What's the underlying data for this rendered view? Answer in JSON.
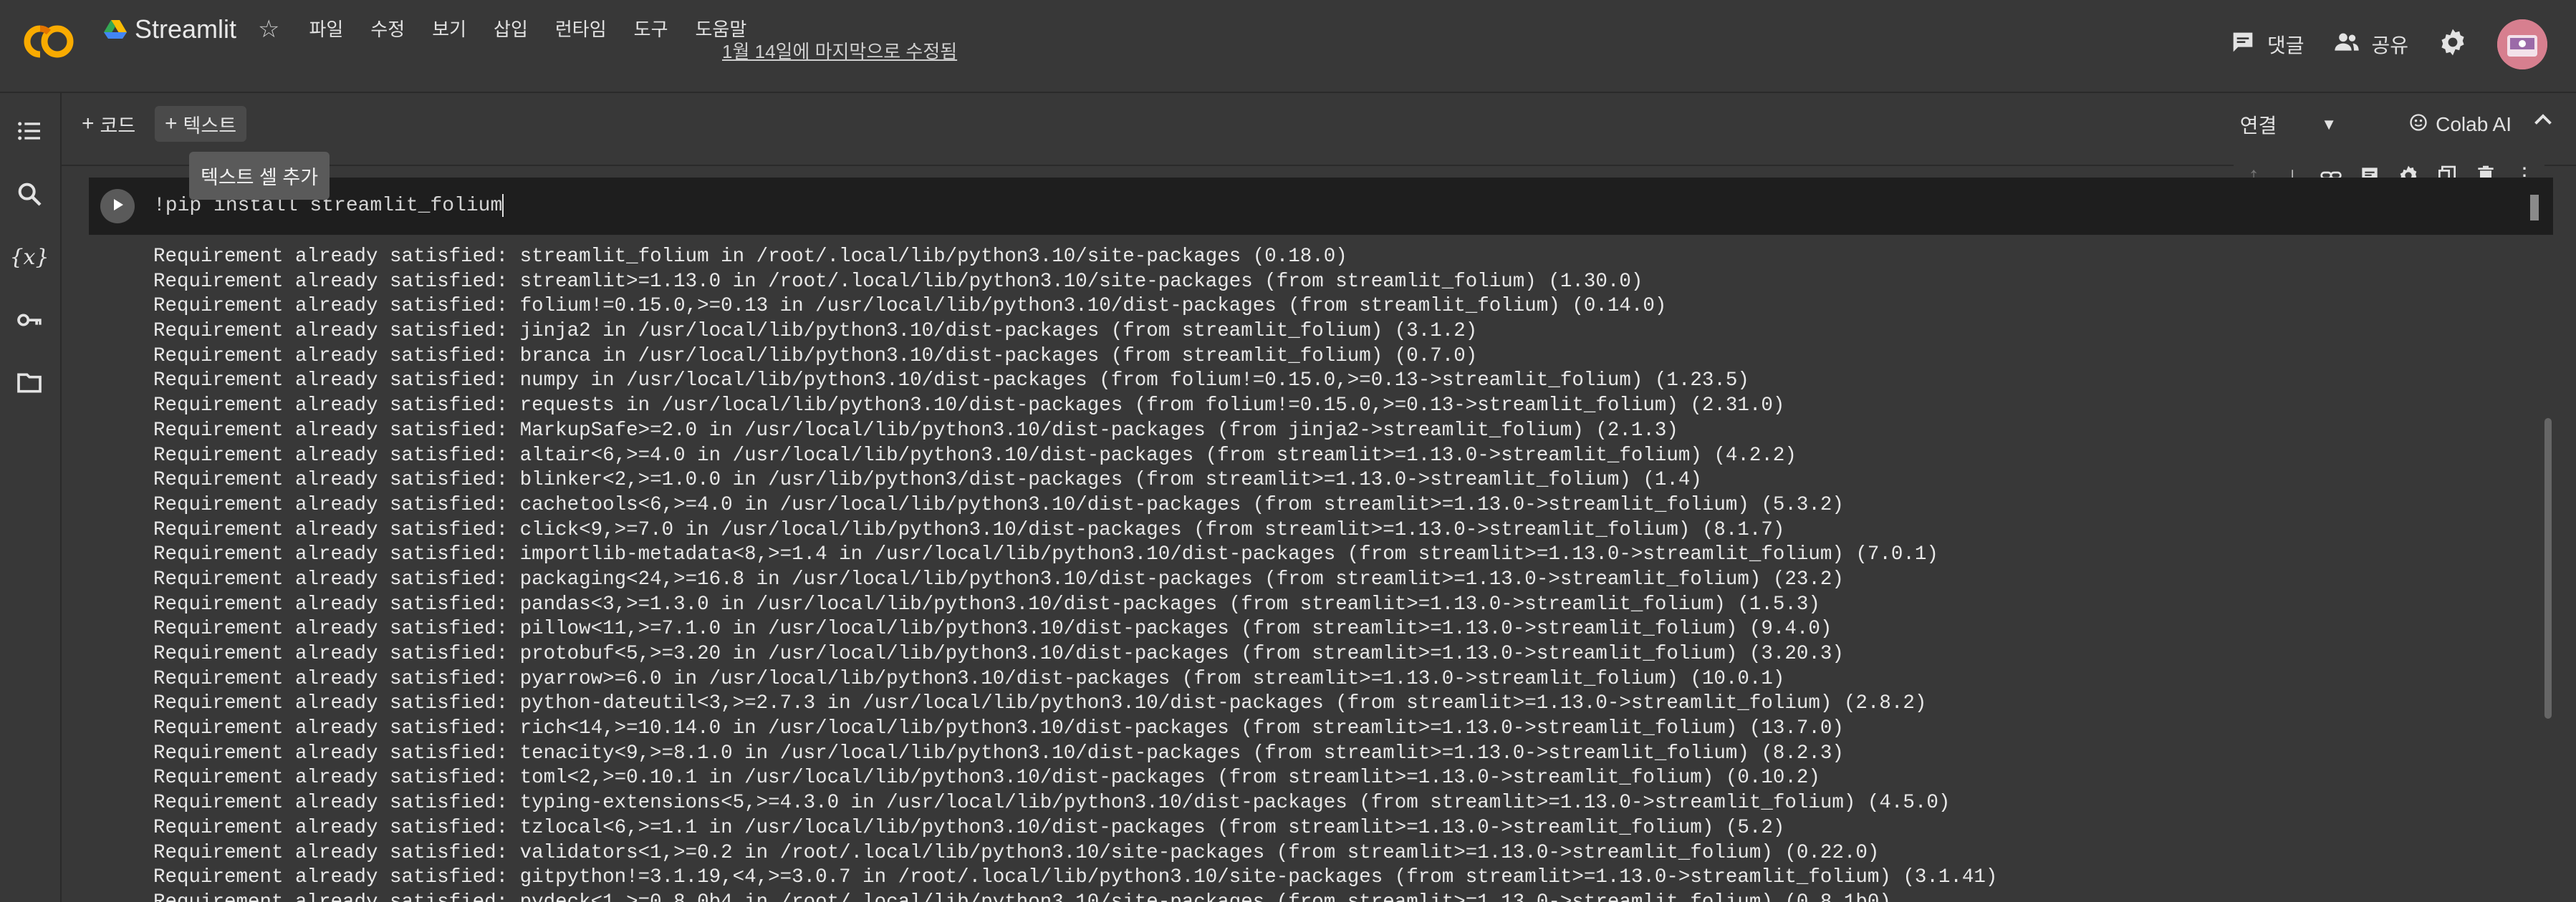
{
  "header": {
    "app_name": "Streamlit",
    "menu": [
      "파일",
      "수정",
      "보기",
      "삽입",
      "런타임",
      "도구",
      "도움말"
    ],
    "last_edited": "1월 14일에 마지막으로 수정됨",
    "comment_label": "댓글",
    "share_label": "공유"
  },
  "toolbar": {
    "code_label": "코드",
    "text_label": "텍스트",
    "tooltip": "텍스트 셀 추가",
    "connect_label": "연결",
    "colab_ai_label": "Colab AI"
  },
  "cell": {
    "code": "!pip install streamlit_folium"
  },
  "output": {
    "lines": [
      "Requirement already satisfied: streamlit_folium in /root/.local/lib/python3.10/site-packages (0.18.0)",
      "Requirement already satisfied: streamlit>=1.13.0 in /root/.local/lib/python3.10/site-packages (from streamlit_folium) (1.30.0)",
      "Requirement already satisfied: folium!=0.15.0,>=0.13 in /usr/local/lib/python3.10/dist-packages (from streamlit_folium) (0.14.0)",
      "Requirement already satisfied: jinja2 in /usr/local/lib/python3.10/dist-packages (from streamlit_folium) (3.1.2)",
      "Requirement already satisfied: branca in /usr/local/lib/python3.10/dist-packages (from streamlit_folium) (0.7.0)",
      "Requirement already satisfied: numpy in /usr/local/lib/python3.10/dist-packages (from folium!=0.15.0,>=0.13->streamlit_folium) (1.23.5)",
      "Requirement already satisfied: requests in /usr/local/lib/python3.10/dist-packages (from folium!=0.15.0,>=0.13->streamlit_folium) (2.31.0)",
      "Requirement already satisfied: MarkupSafe>=2.0 in /usr/local/lib/python3.10/dist-packages (from jinja2->streamlit_folium) (2.1.3)",
      "Requirement already satisfied: altair<6,>=4.0 in /usr/local/lib/python3.10/dist-packages (from streamlit>=1.13.0->streamlit_folium) (4.2.2)",
      "Requirement already satisfied: blinker<2,>=1.0.0 in /usr/lib/python3/dist-packages (from streamlit>=1.13.0->streamlit_folium) (1.4)",
      "Requirement already satisfied: cachetools<6,>=4.0 in /usr/local/lib/python3.10/dist-packages (from streamlit>=1.13.0->streamlit_folium) (5.3.2)",
      "Requirement already satisfied: click<9,>=7.0 in /usr/local/lib/python3.10/dist-packages (from streamlit>=1.13.0->streamlit_folium) (8.1.7)",
      "Requirement already satisfied: importlib-metadata<8,>=1.4 in /usr/local/lib/python3.10/dist-packages (from streamlit>=1.13.0->streamlit_folium) (7.0.1)",
      "Requirement already satisfied: packaging<24,>=16.8 in /usr/local/lib/python3.10/dist-packages (from streamlit>=1.13.0->streamlit_folium) (23.2)",
      "Requirement already satisfied: pandas<3,>=1.3.0 in /usr/local/lib/python3.10/dist-packages (from streamlit>=1.13.0->streamlit_folium) (1.5.3)",
      "Requirement already satisfied: pillow<11,>=7.1.0 in /usr/local/lib/python3.10/dist-packages (from streamlit>=1.13.0->streamlit_folium) (9.4.0)",
      "Requirement already satisfied: protobuf<5,>=3.20 in /usr/local/lib/python3.10/dist-packages (from streamlit>=1.13.0->streamlit_folium) (3.20.3)",
      "Requirement already satisfied: pyarrow>=6.0 in /usr/local/lib/python3.10/dist-packages (from streamlit>=1.13.0->streamlit_folium) (10.0.1)",
      "Requirement already satisfied: python-dateutil<3,>=2.7.3 in /usr/local/lib/python3.10/dist-packages (from streamlit>=1.13.0->streamlit_folium) (2.8.2)",
      "Requirement already satisfied: rich<14,>=10.14.0 in /usr/local/lib/python3.10/dist-packages (from streamlit>=1.13.0->streamlit_folium) (13.7.0)",
      "Requirement already satisfied: tenacity<9,>=8.1.0 in /usr/local/lib/python3.10/dist-packages (from streamlit>=1.13.0->streamlit_folium) (8.2.3)",
      "Requirement already satisfied: toml<2,>=0.10.1 in /usr/local/lib/python3.10/dist-packages (from streamlit>=1.13.0->streamlit_folium) (0.10.2)",
      "Requirement already satisfied: typing-extensions<5,>=4.3.0 in /usr/local/lib/python3.10/dist-packages (from streamlit>=1.13.0->streamlit_folium) (4.5.0)",
      "Requirement already satisfied: tzlocal<6,>=1.1 in /usr/local/lib/python3.10/dist-packages (from streamlit>=1.13.0->streamlit_folium) (5.2)",
      "Requirement already satisfied: validators<1,>=0.2 in /root/.local/lib/python3.10/site-packages (from streamlit>=1.13.0->streamlit_folium) (0.22.0)",
      "Requirement already satisfied: gitpython!=3.1.19,<4,>=3.0.7 in /root/.local/lib/python3.10/site-packages (from streamlit>=1.13.0->streamlit_folium) (3.1.41)",
      "Requirement already satisfied: pydeck<1,>=0.8.0b4 in /root/.local/lib/python3.10/site-packages (from streamlit>=1.13.0->streamlit_folium) (0.8.1b0)"
    ]
  }
}
